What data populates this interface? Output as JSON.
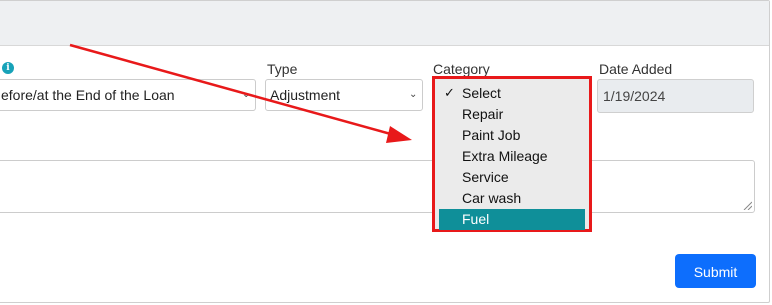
{
  "fields": {
    "first": {
      "value": "efore/at the End of the Loan"
    },
    "type": {
      "label": "Type",
      "value": "Adjustment"
    },
    "category": {
      "label": "Category",
      "options": [
        "Select",
        "Repair",
        "Paint Job",
        "Extra Mileage",
        "Service",
        "Car wash",
        "Fuel"
      ],
      "checked_option": "Select",
      "highlighted_option": "Fuel"
    },
    "date_added": {
      "label": "Date Added",
      "value": "1/19/2024"
    }
  },
  "submit_label": "Submit",
  "annotation": {
    "color": "#e8191a"
  },
  "colors": {
    "accent": "#0d6efd",
    "highlight": "#0f8f99",
    "info": "#17a2b8"
  },
  "icons": [
    "info-icon",
    "chevron-down-icon",
    "checkmark-icon",
    "resize-handle-icon"
  ]
}
